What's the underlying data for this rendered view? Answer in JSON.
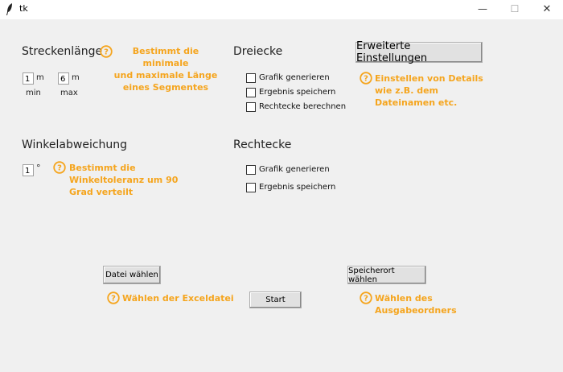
{
  "window": {
    "title": "tk",
    "minimize": "—",
    "maximize": "☐",
    "close": "✕"
  },
  "strecke": {
    "heading": "Streckenlänge",
    "min_value": "1",
    "min_unit": "m",
    "min_label": "min",
    "max_value": "6",
    "max_unit": "m",
    "max_label": "max",
    "help": [
      "Bestimmt die minimale",
      "und maximale Länge",
      "eines Segmentes"
    ]
  },
  "winkel": {
    "heading": "Winkelabweichung",
    "value": "1",
    "unit": "°",
    "help": [
      "Bestimmt die",
      "Winkeltoleranz um 90",
      "Grad verteilt"
    ]
  },
  "dreiecke": {
    "heading": "Dreiecke",
    "options": [
      "Grafik generieren",
      "Ergebnis speichern",
      "Rechtecke berechnen"
    ]
  },
  "rechtecke": {
    "heading": "Rechtecke",
    "options": [
      "Grafik generieren",
      "Ergebnis speichern"
    ]
  },
  "erweitert": {
    "button": "Erweiterte Einstellungen",
    "help": [
      "Einstellen von Details",
      "wie z.B. dem",
      "Dateinamen etc."
    ]
  },
  "datei": {
    "button": "Datei wählen",
    "help": "Wählen der Exceldatei"
  },
  "start": {
    "button": "Start"
  },
  "speicherort": {
    "button": "Speicherort wählen",
    "help": [
      "Wählen des",
      "Ausgabeordners"
    ]
  },
  "colors": {
    "help_text": "#f5a51e",
    "background": "#f0f0f0"
  }
}
